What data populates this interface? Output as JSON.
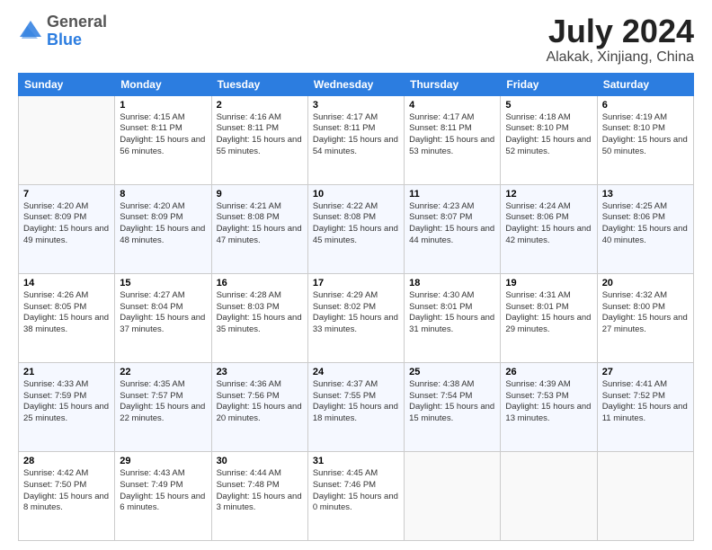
{
  "logo": {
    "general": "General",
    "blue": "Blue"
  },
  "header": {
    "month": "July 2024",
    "location": "Alakak, Xinjiang, China"
  },
  "weekdays": [
    "Sunday",
    "Monday",
    "Tuesday",
    "Wednesday",
    "Thursday",
    "Friday",
    "Saturday"
  ],
  "weeks": [
    [
      {
        "day": "",
        "sunrise": "",
        "sunset": "",
        "daylight": ""
      },
      {
        "day": "1",
        "sunrise": "4:15 AM",
        "sunset": "8:11 PM",
        "daylight": "15 hours and 56 minutes."
      },
      {
        "day": "2",
        "sunrise": "4:16 AM",
        "sunset": "8:11 PM",
        "daylight": "15 hours and 55 minutes."
      },
      {
        "day": "3",
        "sunrise": "4:17 AM",
        "sunset": "8:11 PM",
        "daylight": "15 hours and 54 minutes."
      },
      {
        "day": "4",
        "sunrise": "4:17 AM",
        "sunset": "8:11 PM",
        "daylight": "15 hours and 53 minutes."
      },
      {
        "day": "5",
        "sunrise": "4:18 AM",
        "sunset": "8:10 PM",
        "daylight": "15 hours and 52 minutes."
      },
      {
        "day": "6",
        "sunrise": "4:19 AM",
        "sunset": "8:10 PM",
        "daylight": "15 hours and 50 minutes."
      }
    ],
    [
      {
        "day": "7",
        "sunrise": "4:20 AM",
        "sunset": "8:09 PM",
        "daylight": "15 hours and 49 minutes."
      },
      {
        "day": "8",
        "sunrise": "4:20 AM",
        "sunset": "8:09 PM",
        "daylight": "15 hours and 48 minutes."
      },
      {
        "day": "9",
        "sunrise": "4:21 AM",
        "sunset": "8:08 PM",
        "daylight": "15 hours and 47 minutes."
      },
      {
        "day": "10",
        "sunrise": "4:22 AM",
        "sunset": "8:08 PM",
        "daylight": "15 hours and 45 minutes."
      },
      {
        "day": "11",
        "sunrise": "4:23 AM",
        "sunset": "8:07 PM",
        "daylight": "15 hours and 44 minutes."
      },
      {
        "day": "12",
        "sunrise": "4:24 AM",
        "sunset": "8:06 PM",
        "daylight": "15 hours and 42 minutes."
      },
      {
        "day": "13",
        "sunrise": "4:25 AM",
        "sunset": "8:06 PM",
        "daylight": "15 hours and 40 minutes."
      }
    ],
    [
      {
        "day": "14",
        "sunrise": "4:26 AM",
        "sunset": "8:05 PM",
        "daylight": "15 hours and 38 minutes."
      },
      {
        "day": "15",
        "sunrise": "4:27 AM",
        "sunset": "8:04 PM",
        "daylight": "15 hours and 37 minutes."
      },
      {
        "day": "16",
        "sunrise": "4:28 AM",
        "sunset": "8:03 PM",
        "daylight": "15 hours and 35 minutes."
      },
      {
        "day": "17",
        "sunrise": "4:29 AM",
        "sunset": "8:02 PM",
        "daylight": "15 hours and 33 minutes."
      },
      {
        "day": "18",
        "sunrise": "4:30 AM",
        "sunset": "8:01 PM",
        "daylight": "15 hours and 31 minutes."
      },
      {
        "day": "19",
        "sunrise": "4:31 AM",
        "sunset": "8:01 PM",
        "daylight": "15 hours and 29 minutes."
      },
      {
        "day": "20",
        "sunrise": "4:32 AM",
        "sunset": "8:00 PM",
        "daylight": "15 hours and 27 minutes."
      }
    ],
    [
      {
        "day": "21",
        "sunrise": "4:33 AM",
        "sunset": "7:59 PM",
        "daylight": "15 hours and 25 minutes."
      },
      {
        "day": "22",
        "sunrise": "4:35 AM",
        "sunset": "7:57 PM",
        "daylight": "15 hours and 22 minutes."
      },
      {
        "day": "23",
        "sunrise": "4:36 AM",
        "sunset": "7:56 PM",
        "daylight": "15 hours and 20 minutes."
      },
      {
        "day": "24",
        "sunrise": "4:37 AM",
        "sunset": "7:55 PM",
        "daylight": "15 hours and 18 minutes."
      },
      {
        "day": "25",
        "sunrise": "4:38 AM",
        "sunset": "7:54 PM",
        "daylight": "15 hours and 15 minutes."
      },
      {
        "day": "26",
        "sunrise": "4:39 AM",
        "sunset": "7:53 PM",
        "daylight": "15 hours and 13 minutes."
      },
      {
        "day": "27",
        "sunrise": "4:41 AM",
        "sunset": "7:52 PM",
        "daylight": "15 hours and 11 minutes."
      }
    ],
    [
      {
        "day": "28",
        "sunrise": "4:42 AM",
        "sunset": "7:50 PM",
        "daylight": "15 hours and 8 minutes."
      },
      {
        "day": "29",
        "sunrise": "4:43 AM",
        "sunset": "7:49 PM",
        "daylight": "15 hours and 6 minutes."
      },
      {
        "day": "30",
        "sunrise": "4:44 AM",
        "sunset": "7:48 PM",
        "daylight": "15 hours and 3 minutes."
      },
      {
        "day": "31",
        "sunrise": "4:45 AM",
        "sunset": "7:46 PM",
        "daylight": "15 hours and 0 minutes."
      },
      {
        "day": "",
        "sunrise": "",
        "sunset": "",
        "daylight": ""
      },
      {
        "day": "",
        "sunrise": "",
        "sunset": "",
        "daylight": ""
      },
      {
        "day": "",
        "sunrise": "",
        "sunset": "",
        "daylight": ""
      }
    ]
  ],
  "labels": {
    "sunrise": "Sunrise:",
    "sunset": "Sunset:",
    "daylight": "Daylight:"
  }
}
